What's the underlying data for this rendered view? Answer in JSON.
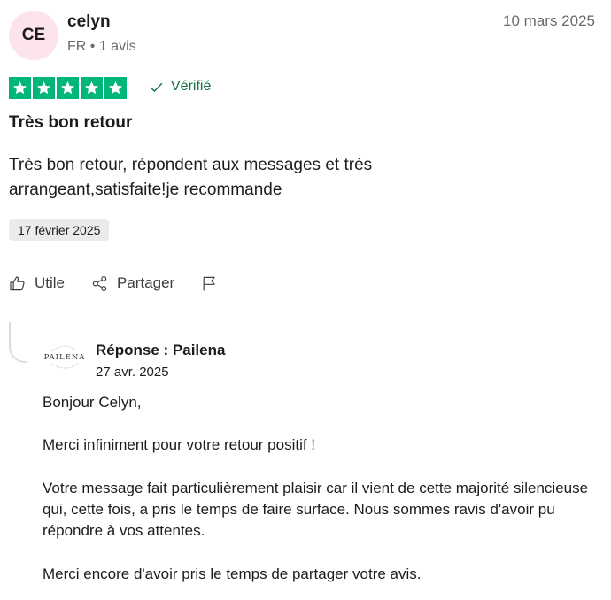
{
  "reviewer": {
    "initials": "CE",
    "name": "celyn",
    "meta": "FR • 1 avis",
    "date": "10 mars 2025"
  },
  "rating": {
    "stars": 5,
    "max": 5,
    "color": "#00b67a"
  },
  "verified_label": "Vérifié",
  "review": {
    "title": "Très bon retour",
    "text": "Très bon retour, répondent aux messages et très arrangeant,satisfaite!je recommande",
    "experience_date": "17 février 2025"
  },
  "actions": {
    "useful_label": "Utile",
    "share_label": "Partager"
  },
  "reply": {
    "logo_text": "PAILENA",
    "title": "Réponse : Pailena",
    "date": "27 avr. 2025",
    "paragraphs": [
      "Bonjour Celyn,",
      "Merci infiniment pour votre retour positif !",
      "Votre message fait particulièrement plaisir car il vient de cette majorité silencieuse qui, cette fois, a pris le temps de faire surface. Nous sommes ravis d'avoir pu répondre à vos attentes.",
      "Merci encore d'avoir pris le temps de partager votre avis."
    ]
  }
}
